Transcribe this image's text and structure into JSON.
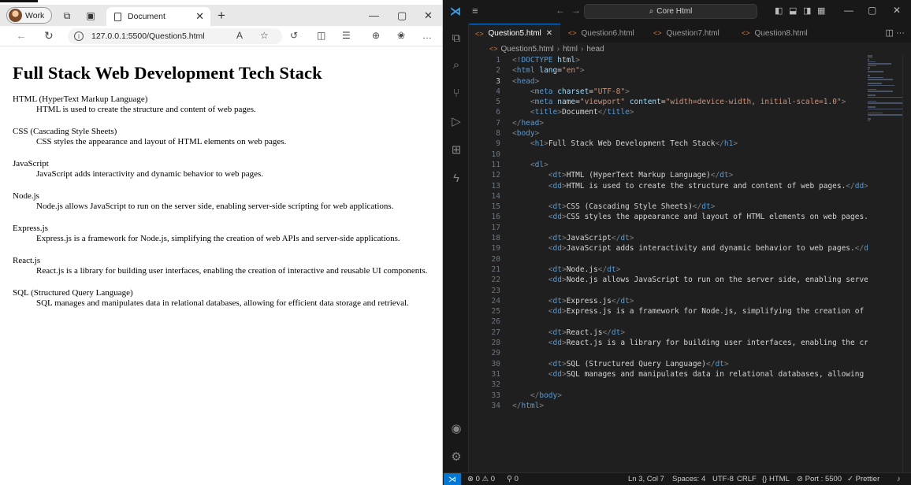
{
  "browser": {
    "profile_label": "Work",
    "tab_title": "Document",
    "url": "127.0.0.1:5500/Question5.html",
    "page": {
      "heading": "Full Stack Web Development Tech Stack",
      "items": [
        {
          "term": "HTML (HyperText Markup Language)",
          "desc": "HTML is used to create the structure and content of web pages."
        },
        {
          "term": "CSS (Cascading Style Sheets)",
          "desc": "CSS styles the appearance and layout of HTML elements on web pages."
        },
        {
          "term": "JavaScript",
          "desc": "JavaScript adds interactivity and dynamic behavior to web pages."
        },
        {
          "term": "Node.js",
          "desc": "Node.js allows JavaScript to run on the server side, enabling server-side scripting for web applications."
        },
        {
          "term": "Express.js",
          "desc": "Express.js is a framework for Node.js, simplifying the creation of web APIs and server-side applications."
        },
        {
          "term": "React.js",
          "desc": "React.js is a library for building user interfaces, enabling the creation of interactive and reusable UI components."
        },
        {
          "term": "SQL (Structured Query Language)",
          "desc": "SQL manages and manipulates data in relational databases, allowing for efficient data storage and retrieval."
        }
      ]
    }
  },
  "vscode": {
    "search_text": "Core Html",
    "tabs": [
      {
        "label": "Question5.html",
        "active": true
      },
      {
        "label": "Question6.html",
        "active": false
      },
      {
        "label": "Question7.html",
        "active": false
      },
      {
        "label": "Question8.html",
        "active": false
      }
    ],
    "breadcrumb": [
      "Question5.html",
      "html",
      "head"
    ],
    "current_line": 3,
    "status": {
      "errors": "0",
      "warnings": "0",
      "ports": "0",
      "position": "Ln 3, Col 7",
      "spaces": "Spaces: 4",
      "encoding": "UTF-8",
      "eol": "CRLF",
      "language": "HTML",
      "port": "Port : 5500",
      "formatter": "Prettier"
    },
    "colors": {
      "accent": "#0078d4",
      "tag": "#569cd6",
      "attr": "#9cdcfe",
      "string": "#ce9178",
      "html_icon": "#e37933"
    },
    "code_lines": [
      [
        [
          "br",
          "<!"
        ],
        [
          "tag",
          "DOCTYPE"
        ],
        [
          "txt",
          " "
        ],
        [
          "attr",
          "html"
        ],
        [
          "br",
          ">"
        ]
      ],
      [
        [
          "br",
          "<"
        ],
        [
          "tag",
          "html"
        ],
        [
          "txt",
          " "
        ],
        [
          "attr",
          "lang"
        ],
        [
          "txt",
          "="
        ],
        [
          "str",
          "\"en\""
        ],
        [
          "br",
          ">"
        ]
      ],
      [
        [
          "br",
          "<"
        ],
        [
          "tag",
          "head"
        ],
        [
          "br",
          ">"
        ]
      ],
      [
        [
          "txt",
          "    "
        ],
        [
          "br",
          "<"
        ],
        [
          "tag",
          "meta"
        ],
        [
          "txt",
          " "
        ],
        [
          "attr",
          "charset"
        ],
        [
          "txt",
          "="
        ],
        [
          "str",
          "\"UTF-8\""
        ],
        [
          "br",
          ">"
        ]
      ],
      [
        [
          "txt",
          "    "
        ],
        [
          "br",
          "<"
        ],
        [
          "tag",
          "meta"
        ],
        [
          "txt",
          " "
        ],
        [
          "attr",
          "name"
        ],
        [
          "txt",
          "="
        ],
        [
          "str",
          "\"viewport\""
        ],
        [
          "txt",
          " "
        ],
        [
          "attr",
          "content"
        ],
        [
          "txt",
          "="
        ],
        [
          "str",
          "\"width=device-width, initial-scale=1.0\""
        ],
        [
          "br",
          ">"
        ]
      ],
      [
        [
          "txt",
          "    "
        ],
        [
          "br",
          "<"
        ],
        [
          "tag",
          "title"
        ],
        [
          "br",
          ">"
        ],
        [
          "txt",
          "Document"
        ],
        [
          "br",
          "</"
        ],
        [
          "tag",
          "title"
        ],
        [
          "br",
          ">"
        ]
      ],
      [
        [
          "br",
          "</"
        ],
        [
          "tag",
          "head"
        ],
        [
          "br",
          ">"
        ]
      ],
      [
        [
          "br",
          "<"
        ],
        [
          "tag",
          "body"
        ],
        [
          "br",
          ">"
        ]
      ],
      [
        [
          "txt",
          "    "
        ],
        [
          "br",
          "<"
        ],
        [
          "tag",
          "h1"
        ],
        [
          "br",
          ">"
        ],
        [
          "txt",
          "Full Stack Web Development Tech Stack"
        ],
        [
          "br",
          "</"
        ],
        [
          "tag",
          "h1"
        ],
        [
          "br",
          ">"
        ]
      ],
      [],
      [
        [
          "txt",
          "    "
        ],
        [
          "br",
          "<"
        ],
        [
          "tag",
          "dl"
        ],
        [
          "br",
          ">"
        ]
      ],
      [
        [
          "txt",
          "        "
        ],
        [
          "br",
          "<"
        ],
        [
          "tag",
          "dt"
        ],
        [
          "br",
          ">"
        ],
        [
          "txt",
          "HTML (HyperText Markup Language)"
        ],
        [
          "br",
          "</"
        ],
        [
          "tag",
          "dt"
        ],
        [
          "br",
          ">"
        ]
      ],
      [
        [
          "txt",
          "        "
        ],
        [
          "br",
          "<"
        ],
        [
          "tag",
          "dd"
        ],
        [
          "br",
          ">"
        ],
        [
          "txt",
          "HTML is used to create the structure and content of web pages."
        ],
        [
          "br",
          "</"
        ],
        [
          "tag",
          "dd"
        ],
        [
          "br",
          ">"
        ]
      ],
      [],
      [
        [
          "txt",
          "        "
        ],
        [
          "br",
          "<"
        ],
        [
          "tag",
          "dt"
        ],
        [
          "br",
          ">"
        ],
        [
          "txt",
          "CSS (Cascading Style Sheets)"
        ],
        [
          "br",
          "</"
        ],
        [
          "tag",
          "dt"
        ],
        [
          "br",
          ">"
        ]
      ],
      [
        [
          "txt",
          "        "
        ],
        [
          "br",
          "<"
        ],
        [
          "tag",
          "dd"
        ],
        [
          "br",
          ">"
        ],
        [
          "txt",
          "CSS styles the appearance and layout of HTML elements on web pages."
        ],
        [
          "br",
          "</"
        ],
        [
          "tag",
          "dd"
        ],
        [
          "br",
          ">"
        ]
      ],
      [],
      [
        [
          "txt",
          "        "
        ],
        [
          "br",
          "<"
        ],
        [
          "tag",
          "dt"
        ],
        [
          "br",
          ">"
        ],
        [
          "txt",
          "JavaScript"
        ],
        [
          "br",
          "</"
        ],
        [
          "tag",
          "dt"
        ],
        [
          "br",
          ">"
        ]
      ],
      [
        [
          "txt",
          "        "
        ],
        [
          "br",
          "<"
        ],
        [
          "tag",
          "dd"
        ],
        [
          "br",
          ">"
        ],
        [
          "txt",
          "JavaScript adds interactivity and dynamic behavior to web pages."
        ],
        [
          "br",
          "</"
        ],
        [
          "tag",
          "dd"
        ],
        [
          "br",
          ">"
        ]
      ],
      [],
      [
        [
          "txt",
          "        "
        ],
        [
          "br",
          "<"
        ],
        [
          "tag",
          "dt"
        ],
        [
          "br",
          ">"
        ],
        [
          "txt",
          "Node.js"
        ],
        [
          "br",
          "</"
        ],
        [
          "tag",
          "dt"
        ],
        [
          "br",
          ">"
        ]
      ],
      [
        [
          "txt",
          "        "
        ],
        [
          "br",
          "<"
        ],
        [
          "tag",
          "dd"
        ],
        [
          "br",
          ">"
        ],
        [
          "txt",
          "Node.js allows JavaScript to run on the server side, enabling server-side scripting for web applications."
        ],
        [
          "br",
          "</"
        ],
        [
          "tag",
          "dd"
        ],
        [
          "br",
          ">"
        ]
      ],
      [],
      [
        [
          "txt",
          "        "
        ],
        [
          "br",
          "<"
        ],
        [
          "tag",
          "dt"
        ],
        [
          "br",
          ">"
        ],
        [
          "txt",
          "Express.js"
        ],
        [
          "br",
          "</"
        ],
        [
          "tag",
          "dt"
        ],
        [
          "br",
          ">"
        ]
      ],
      [
        [
          "txt",
          "        "
        ],
        [
          "br",
          "<"
        ],
        [
          "tag",
          "dd"
        ],
        [
          "br",
          ">"
        ],
        [
          "txt",
          "Express.js is a framework for Node.js, simplifying the creation of web APIs and server-side applications."
        ],
        [
          "br",
          "</"
        ],
        [
          "tag",
          "dd"
        ],
        [
          "br",
          ">"
        ]
      ],
      [],
      [
        [
          "txt",
          "        "
        ],
        [
          "br",
          "<"
        ],
        [
          "tag",
          "dt"
        ],
        [
          "br",
          ">"
        ],
        [
          "txt",
          "React.js"
        ],
        [
          "br",
          "</"
        ],
        [
          "tag",
          "dt"
        ],
        [
          "br",
          ">"
        ]
      ],
      [
        [
          "txt",
          "        "
        ],
        [
          "br",
          "<"
        ],
        [
          "tag",
          "dd"
        ],
        [
          "br",
          ">"
        ],
        [
          "txt",
          "React.js is a library for building user interfaces, enabling the creation of interactive and reusable UI components."
        ],
        [
          "br",
          "</"
        ],
        [
          "tag",
          "dd"
        ],
        [
          "br",
          ">"
        ]
      ],
      [],
      [
        [
          "txt",
          "        "
        ],
        [
          "br",
          "<"
        ],
        [
          "tag",
          "dt"
        ],
        [
          "br",
          ">"
        ],
        [
          "txt",
          "SQL (Structured Query Language)"
        ],
        [
          "br",
          "</"
        ],
        [
          "tag",
          "dt"
        ],
        [
          "br",
          ">"
        ]
      ],
      [
        [
          "txt",
          "        "
        ],
        [
          "br",
          "<"
        ],
        [
          "tag",
          "dd"
        ],
        [
          "br",
          ">"
        ],
        [
          "txt",
          "SQL manages and manipulates data in relational databases, allowing for efficient data storage and retrieval."
        ],
        [
          "br",
          "</"
        ],
        [
          "tag",
          "dd"
        ],
        [
          "br",
          ">"
        ]
      ],
      [],
      [
        [
          "txt",
          "    "
        ],
        [
          "br",
          "</"
        ],
        [
          "tag",
          "body"
        ],
        [
          "br",
          ">"
        ]
      ],
      [
        [
          "br",
          "</"
        ],
        [
          "tag",
          "html"
        ],
        [
          "br",
          ">"
        ]
      ]
    ]
  }
}
